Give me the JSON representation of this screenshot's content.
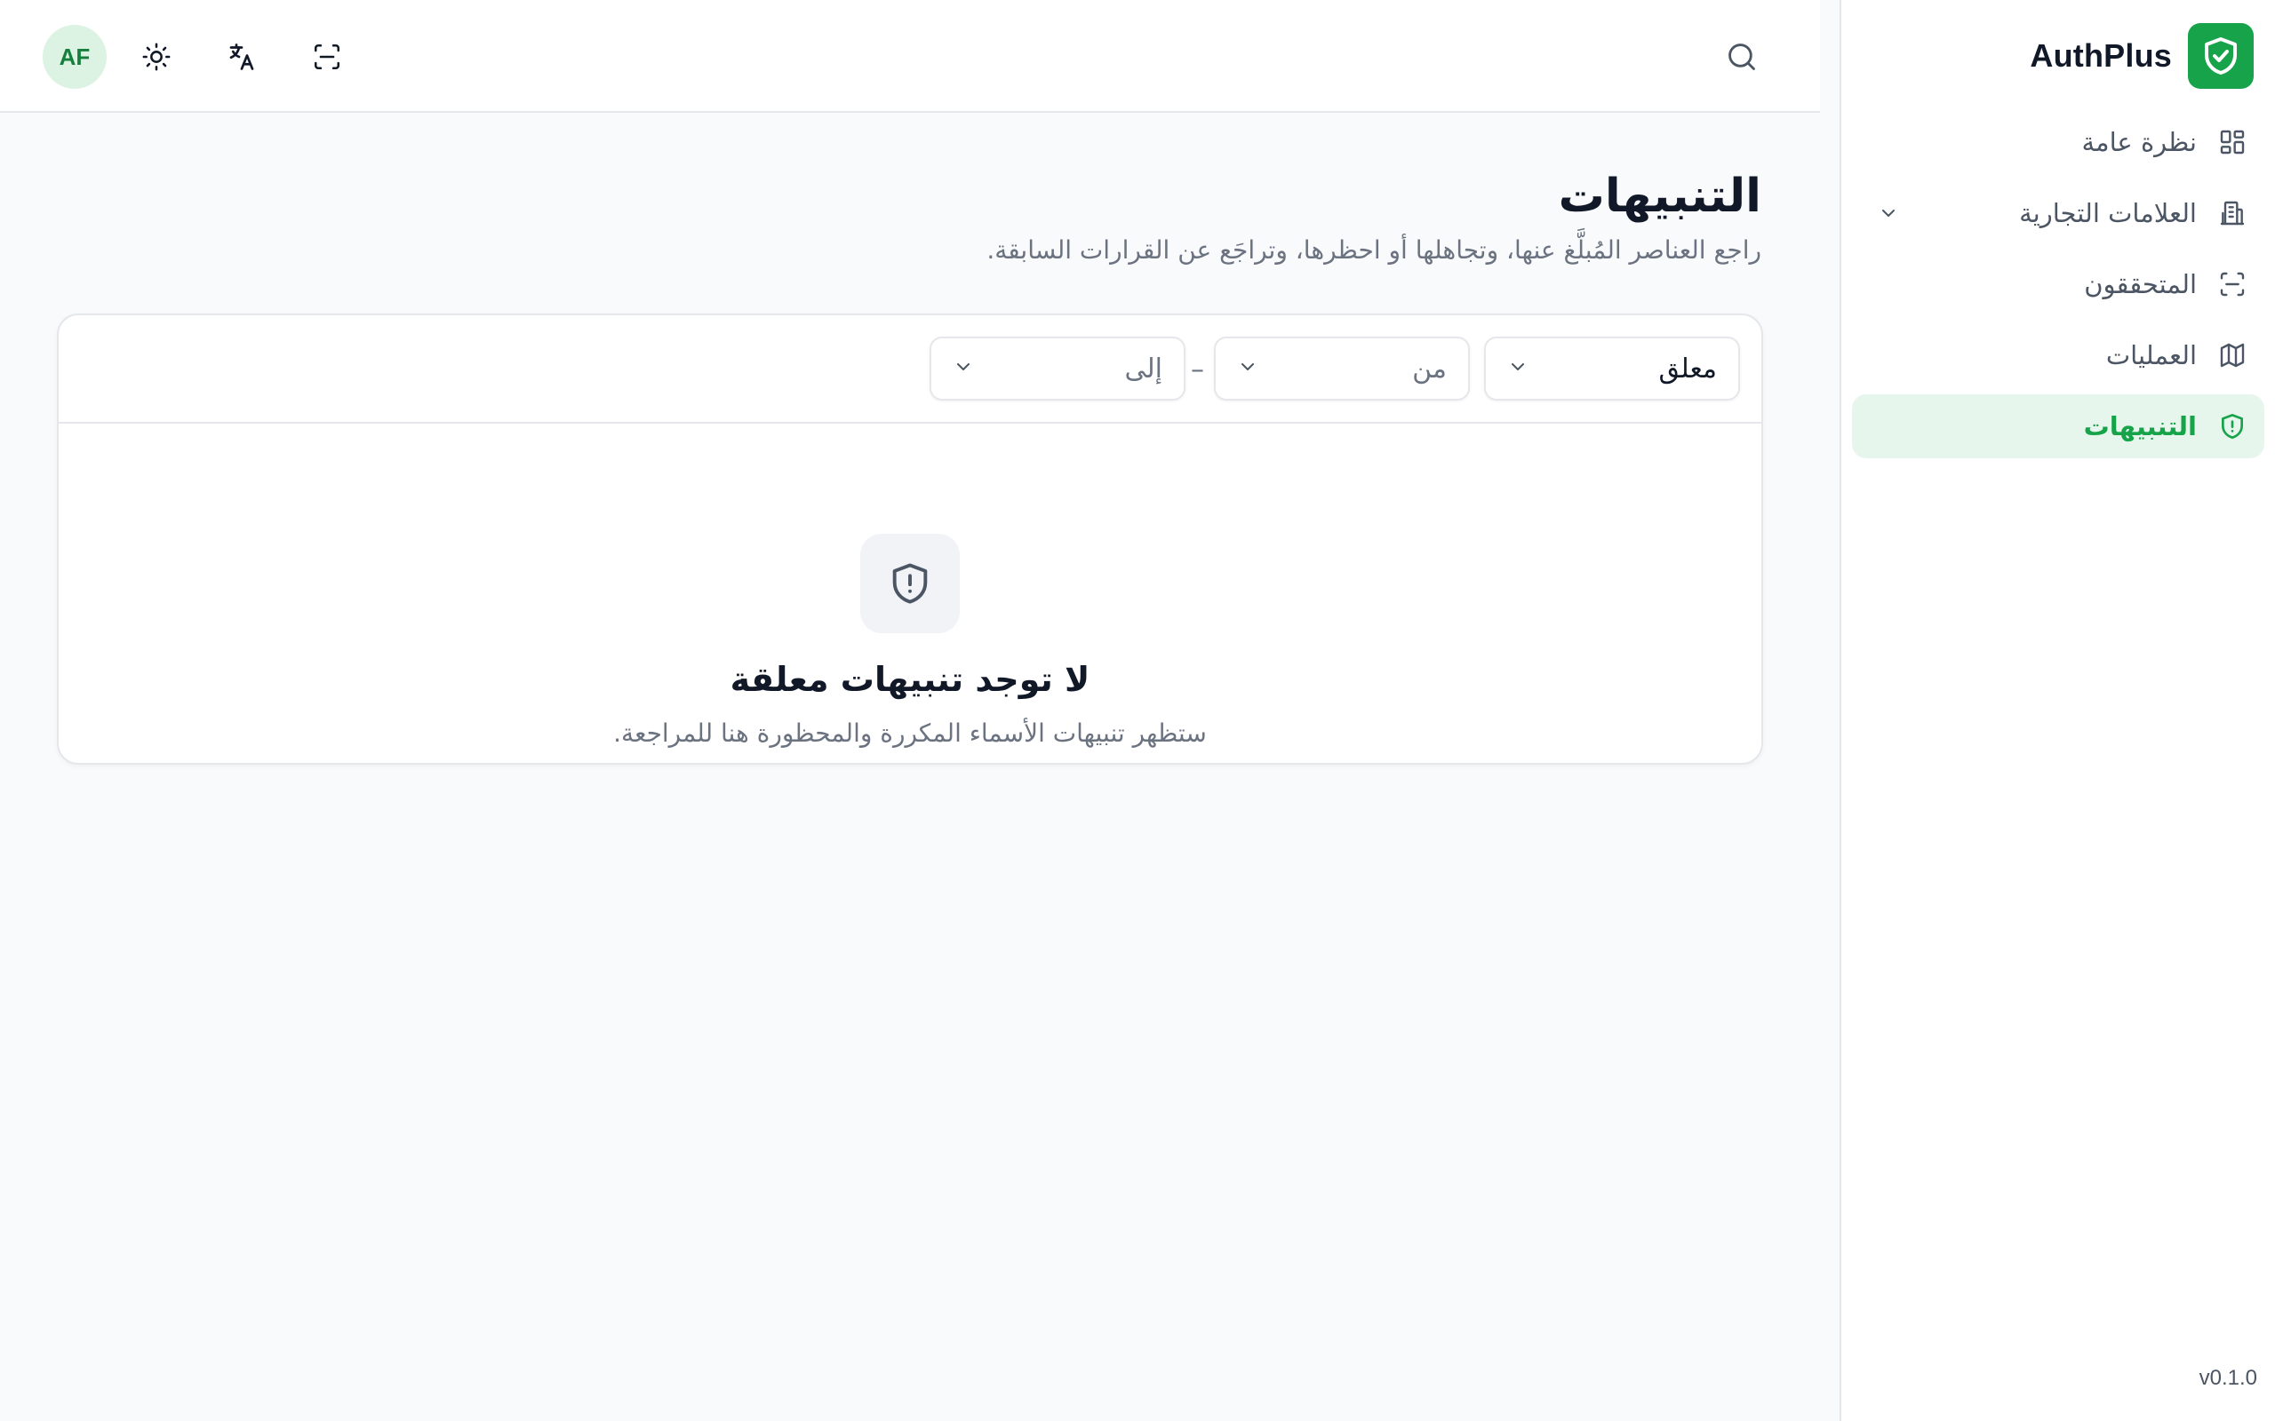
{
  "brand": {
    "name": "AuthPlus",
    "logo_icon": "shield-check-icon",
    "color": "#16a34a"
  },
  "sidebar": {
    "items": [
      {
        "label": "نظرة عامة",
        "icon": "dashboard-grid-icon",
        "active": false
      },
      {
        "label": "العلامات التجارية",
        "icon": "building-icon",
        "active": false,
        "expandable": true
      },
      {
        "label": "المتحققون",
        "icon": "scan-icon",
        "active": false
      },
      {
        "label": "العمليات",
        "icon": "map-icon",
        "active": false
      },
      {
        "label": "التنبيهات",
        "icon": "shield-alert-icon",
        "active": true
      }
    ],
    "version": "v0.1.0"
  },
  "topbar": {
    "avatar_initials": "AF",
    "icons": [
      "sun-icon",
      "language-icon",
      "scan-icon",
      "search-icon"
    ]
  },
  "page": {
    "title": "التنبيهات",
    "subtitle": "راجع العناصر المُبلَّغ عنها، وتجاهلها أو احظرها، وتراجَع عن القرارات السابقة."
  },
  "filters": {
    "status_value": "معلق",
    "from_placeholder": "من",
    "to_placeholder": "إلى",
    "separator": "–"
  },
  "empty_state": {
    "icon": "shield-alert-icon",
    "title": "لا توجد تنبيهات معلقة",
    "description": "ستظهر تنبيهات الأسماء المكررة والمحظورة هنا للمراجعة."
  },
  "colors": {
    "accent": "#16a34a",
    "accent_bg": "#e7f6ec",
    "background": "#f8fafc",
    "border": "#e5e7eb"
  }
}
